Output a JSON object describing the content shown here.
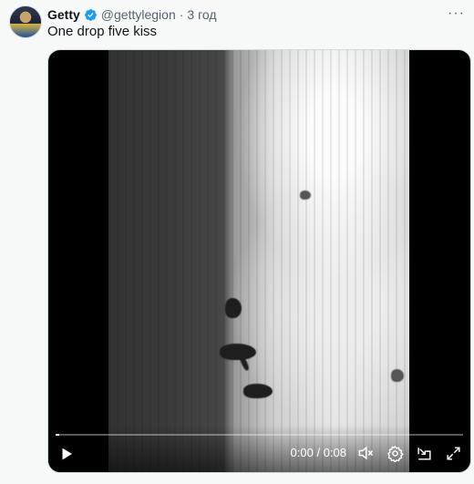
{
  "tweet": {
    "author_name": "Getty",
    "handle": "@gettylegion",
    "separator": "·",
    "time_ago": "3 год",
    "more_label": "···",
    "text": "One drop five kiss"
  },
  "media": {
    "type": "video",
    "current_time": "0:00",
    "time_divider": "/",
    "duration": "0:08",
    "progress_fraction": 0.0
  },
  "icons": {
    "verified": "verified-badge-icon",
    "play": "play-icon",
    "mute": "mute-icon",
    "settings": "gear-icon",
    "pip": "picture-in-picture-icon",
    "fullscreen": "fullscreen-icon"
  },
  "colors": {
    "verified": "#1d9bf0",
    "text": "#0f1419",
    "secondary": "#536471"
  }
}
